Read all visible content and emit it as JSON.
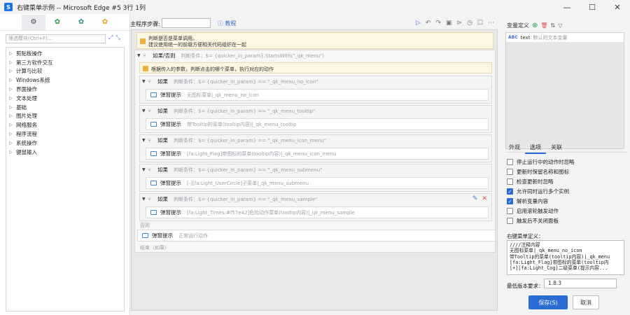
{
  "window": {
    "title": "右键菜单示例 -- Microsoft Edge #5 3行 1列",
    "controls": [
      "—",
      "☐",
      "✕"
    ]
  },
  "left": {
    "search_placeholder": "筛选模块(Ctrl+F)...",
    "tree": [
      "剪贴板操作",
      "第三方软件交互",
      "计算与比较",
      "Windows系统",
      "界面操作",
      "文本处理",
      "基础",
      "图片处理",
      "网络服务",
      "程序流程",
      "系统操作",
      "键鼠输入"
    ]
  },
  "editor": {
    "step_label": "主程序步骤:",
    "help_link": "教程",
    "note1_line1": "判断是否是菜单调用。",
    "note1_line2": "建议使用统一的前缀方便相关代码组织在一起",
    "if_main": {
      "kw": "如果/否则",
      "cond": "判断条件：$= {quicker_in_param}.StartsWith(\"_qk_menu\")"
    },
    "note2": "根据传入的参数，判断点击的哪个菜单，执行对应的动作",
    "branches": [
      {
        "kw": "如果",
        "cond": "判断条件：$= {quicker_in_param} == \"_qk_menu_no_icon\"",
        "action": "弹窗提示",
        "desc": "无图标菜单|_qk_menu_no_icon"
      },
      {
        "kw": "如果",
        "cond": "判断条件：$= {quicker_in_param} == \"_qk_menu_tooltip\"",
        "action": "弹窗提示",
        "desc": "带Tooltip的菜单(tooltip内容)|_qk_menu_tooltip"
      },
      {
        "kw": "如果",
        "cond": "判断条件：$= {quicker_in_param} == \"_qk_menu_icon_menu\"",
        "action": "弹窗提示",
        "desc": "[fa:Light_Flag]带图标的菜单(tooltip内容)|_qk_menu_icon_menu"
      },
      {
        "kw": "如果",
        "cond": "判断条件：$= {quicker_in_param} == \"_qk_menu_submenu\"",
        "action": "弹窗提示",
        "desc": "[-][fa:Light_UserCircle]子菜单|_qk_menu_submenu"
      },
      {
        "kw": "如果",
        "cond": "判断条件：$= {quicker_in_param} == \"_qk_menu_sample\"",
        "action": "弹窗提示",
        "desc": "[fa:Light_Times:#f57e42]危险动作菜单(tooltip内容)|_qk_menu_sample"
      }
    ],
    "else_label": "否则",
    "else_action": "弹窗提示",
    "else_desc": "正常运行动作",
    "end_label": "结束（如果）"
  },
  "right": {
    "var_title": "变量定义",
    "var_row": {
      "type": "ABC",
      "name": "text",
      "desc": "默认的文本变量"
    },
    "tabs": [
      "外观",
      "选项",
      "关联"
    ],
    "active_tab": "选项",
    "options": [
      {
        "label": "停止运行中的动作时忽略",
        "checked": false
      },
      {
        "label": "更新时保留名称和图标",
        "checked": false
      },
      {
        "label": "检查更新时忽略",
        "checked": false
      },
      {
        "label": "允许同时运行多个实例",
        "checked": true
      },
      {
        "label": "解析变量内容",
        "checked": true
      },
      {
        "label": "启用滚轮触发动作",
        "checked": false
      },
      {
        "label": "触发后不关闭面板",
        "checked": false
      }
    ],
    "menu_label": "右键菜单定义：",
    "menu_text": "////注释内容\n无图标菜单|_qk_menu_no_icon\n带Tooltip的菜单(tooltip内容)|_qk_menu\n[fa:Light_Flag]带图标的菜单(tooltip内\n[+][fa:Light_Cog]二级菜单(提示内容...",
    "minver_label": "最低版本要求：",
    "minver_value": "1.8.3",
    "save_label": "保存(S)",
    "cancel_label": "取消"
  }
}
